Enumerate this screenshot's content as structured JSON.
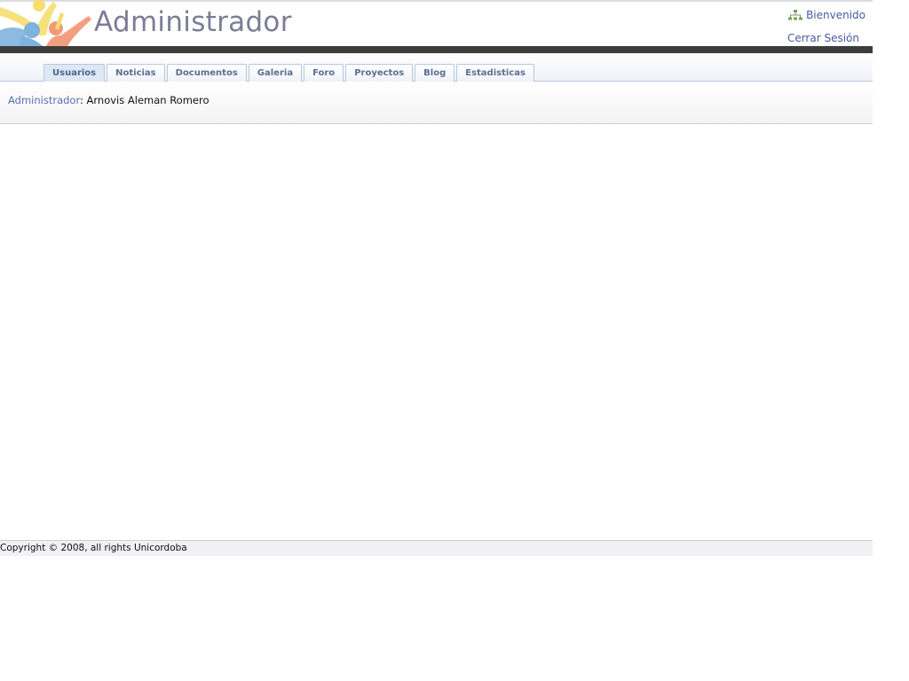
{
  "header": {
    "title": "Administrador",
    "welcome_label": "Bienvenido",
    "logout_label": "Cerrar Sesión"
  },
  "tabs": [
    {
      "label": "Usuarios",
      "active": true
    },
    {
      "label": "Noticias",
      "active": false
    },
    {
      "label": "Documentos",
      "active": false
    },
    {
      "label": "Galeria",
      "active": false
    },
    {
      "label": "Foro",
      "active": false
    },
    {
      "label": "Proyectos",
      "active": false
    },
    {
      "label": "Blog",
      "active": false
    },
    {
      "label": "Estadisticas",
      "active": false
    }
  ],
  "userbar": {
    "role": "Administrador",
    "separator": ":",
    "name": "Arnovis Aleman Romero"
  },
  "footer": {
    "text": "Copyright © 2008, all rights Unicordoba"
  },
  "icons": {
    "logo": "people-logo",
    "welcome": "sitemap-icon"
  },
  "colors": {
    "title": "#7c7d95",
    "link": "#4a59a6",
    "tab_text": "#5b6f93",
    "dark_bar": "#3d3d3d"
  }
}
